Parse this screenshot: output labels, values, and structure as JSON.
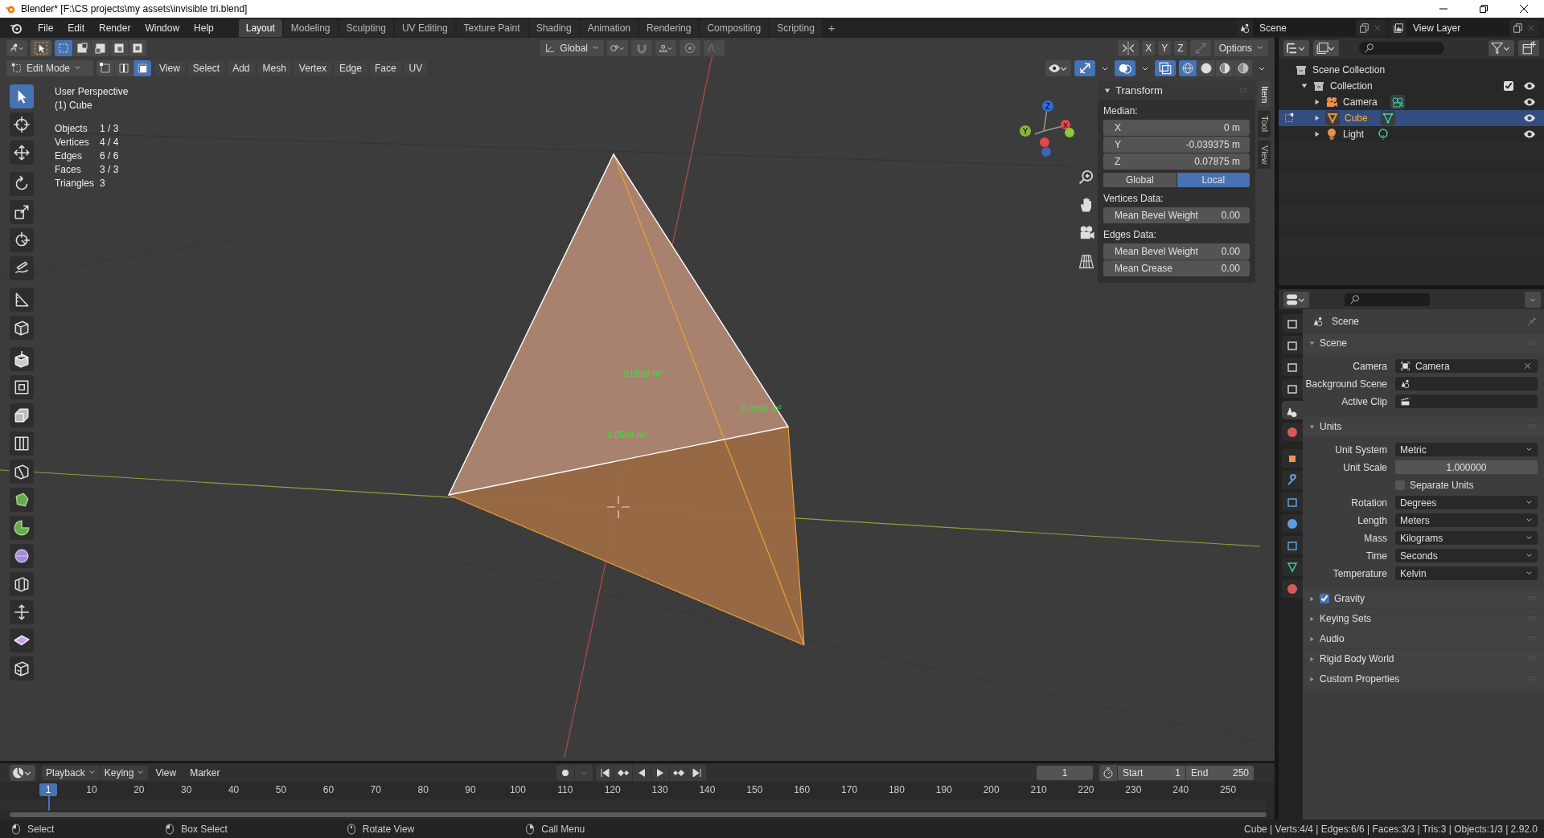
{
  "title_bar": {
    "title": "Blender* [F:\\CS projects\\my assets\\invisible tri.blend]"
  },
  "menu": [
    "File",
    "Edit",
    "Render",
    "Window",
    "Help"
  ],
  "workspaces": [
    {
      "label": "Layout",
      "selected": true
    },
    {
      "label": "Modeling",
      "selected": false
    },
    {
      "label": "Sculpting",
      "selected": false
    },
    {
      "label": "UV Editing",
      "selected": false
    },
    {
      "label": "Texture Paint",
      "selected": false
    },
    {
      "label": "Shading",
      "selected": false
    },
    {
      "label": "Animation",
      "selected": false
    },
    {
      "label": "Rendering",
      "selected": false
    },
    {
      "label": "Compositing",
      "selected": false
    },
    {
      "label": "Scripting",
      "selected": false
    }
  ],
  "add_workspace": "+",
  "scene_field": {
    "value": "Scene"
  },
  "view_layer_field": {
    "value": "View Layer"
  },
  "viewport": {
    "tool_header": {
      "select_modes": [
        {
          "selected": true
        },
        {
          "selected": false
        },
        {
          "selected": false
        },
        {
          "selected": false
        },
        {
          "selected": false
        }
      ],
      "orientation": "Global",
      "mirror_axes": [
        "X",
        "Y",
        "Z"
      ],
      "options": "Options"
    },
    "header": {
      "mode": "Edit Mode",
      "element_modes": [
        {
          "selected": false
        },
        {
          "selected": false
        },
        {
          "selected": true
        }
      ],
      "menus": [
        "View",
        "Select",
        "Add",
        "Mesh",
        "Vertex",
        "Edge",
        "Face",
        "UV"
      ],
      "gizmos_on": true,
      "overlays_on": true,
      "xray_on": true,
      "shading": [
        {
          "selected": true
        },
        {
          "selected": false
        },
        {
          "selected": false
        },
        {
          "selected": false
        }
      ]
    },
    "tools": [
      {
        "selected": true
      },
      {
        "selected": false
      },
      {
        "selected": false
      },
      {
        "selected": false
      },
      {
        "selected": false
      },
      {
        "selected": false
      },
      {
        "selected": false
      },
      {
        "selected": false
      },
      {
        "selected": false
      },
      {
        "selected": false
      },
      {
        "selected": false
      },
      {
        "selected": false
      },
      {
        "selected": false
      },
      {
        "selected": false
      },
      {
        "selected": false
      },
      {
        "selected": false
      },
      {
        "selected": false
      },
      {
        "selected": false
      },
      {
        "selected": false
      },
      {
        "selected": false
      },
      {
        "selected": false
      }
    ],
    "info": {
      "view": "User Perspective",
      "object": "(1) Cube",
      "stats": [
        {
          "label": "Objects",
          "value": "1 / 3"
        },
        {
          "label": "Vertices",
          "value": "4 / 4"
        },
        {
          "label": "Edges",
          "value": "6 / 6"
        },
        {
          "label": "Faces",
          "value": "3 / 3"
        },
        {
          "label": "Triangles",
          "value": "3"
        }
      ]
    },
    "area_labels": [
      "0.0568 m²",
      "0.0555 m²",
      "0.0568 m²"
    ],
    "gizmo_axes": [
      "X",
      "Y",
      "Z"
    ],
    "sidebar": {
      "panel": "Transform",
      "median_label": "Median:",
      "fields": [
        {
          "label": "X",
          "value": "0 m"
        },
        {
          "label": "Y",
          "value": "-0.039375 m"
        },
        {
          "label": "Z",
          "value": "0.07875 m"
        }
      ],
      "space": [
        {
          "label": "Global",
          "selected": false
        },
        {
          "label": "Local",
          "selected": true
        }
      ],
      "vertices_label": "Vertices Data:",
      "vertex_fields": [
        {
          "label": "Mean Bevel Weight",
          "value": "0.00"
        }
      ],
      "edges_label": "Edges Data:",
      "edge_fields": [
        {
          "label": "Mean Bevel Weight",
          "value": "0.00"
        },
        {
          "label": "Mean Crease",
          "value": "0.00"
        }
      ]
    },
    "tabs": [
      {
        "label": "Item",
        "selected": true
      },
      {
        "label": "Tool",
        "selected": false
      },
      {
        "label": "View",
        "selected": false
      }
    ]
  },
  "outliner": {
    "root": "Scene Collection",
    "collection": {
      "name": "Collection",
      "expanded": true,
      "checked": true,
      "children": [
        {
          "name": "Camera",
          "kind": "camera",
          "selected": false
        },
        {
          "name": "Cube",
          "kind": "mesh",
          "selected": true
        },
        {
          "name": "Light",
          "kind": "light",
          "selected": false
        }
      ]
    }
  },
  "properties": {
    "tabs": [
      {
        "selected": false
      },
      {
        "selected": false
      },
      {
        "selected": false
      },
      {
        "selected": false
      },
      {
        "selected": true
      },
      {
        "selected": false
      },
      {
        "selected": false
      },
      {
        "selected": false
      },
      {
        "selected": false
      },
      {
        "selected": false
      },
      {
        "selected": false
      },
      {
        "selected": false
      },
      {
        "selected": false
      }
    ],
    "context": "Scene",
    "panels": [
      {
        "title": "Scene",
        "expanded": true,
        "rows": [
          {
            "kind": "camera",
            "label": "Camera",
            "value": "Camera"
          },
          {
            "kind": "scene",
            "label": "Background Scene"
          },
          {
            "kind": "clip",
            "label": "Active Clip"
          }
        ]
      },
      {
        "title": "Units",
        "expanded": true,
        "rows": [
          {
            "kind": "select",
            "label": "Unit System",
            "value": "Metric"
          },
          {
            "kind": "number",
            "label": "Unit Scale",
            "value": "1.000000"
          },
          {
            "kind": "checkbox",
            "label": "Separate Units",
            "checked": false
          },
          {
            "kind": "select",
            "label": "Rotation",
            "value": "Degrees"
          },
          {
            "kind": "select",
            "label": "Length",
            "value": "Meters"
          },
          {
            "kind": "select",
            "label": "Mass",
            "value": "Kilograms"
          },
          {
            "kind": "select",
            "label": "Time",
            "value": "Seconds"
          },
          {
            "kind": "select",
            "label": "Temperature",
            "value": "Kelvin"
          }
        ]
      },
      {
        "title": "Gravity",
        "expanded": false,
        "checked": true
      },
      {
        "title": "Keying Sets",
        "expanded": false
      },
      {
        "title": "Audio",
        "expanded": false
      },
      {
        "title": "Rigid Body World",
        "expanded": false
      },
      {
        "title": "Custom Properties",
        "expanded": false
      }
    ]
  },
  "timeline": {
    "menus": [
      {
        "label": "Playback",
        "kind": "dropdown"
      },
      {
        "label": "Keying",
        "kind": "dropdown"
      },
      {
        "label": "View",
        "kind": "menu"
      },
      {
        "label": "Marker",
        "kind": "menu"
      }
    ],
    "current_frame": "1",
    "start_label": "Start",
    "start": "1",
    "end_label": "End",
    "end": "250",
    "playhead": "1",
    "ruler": [
      "10",
      "20",
      "30",
      "40",
      "50",
      "60",
      "70",
      "80",
      "90",
      "100",
      "110",
      "120",
      "130",
      "140",
      "150",
      "160",
      "170",
      "180",
      "190",
      "200",
      "210",
      "220",
      "230",
      "240",
      "250"
    ]
  },
  "status_bar": {
    "hints": [
      {
        "kind": "left",
        "label": "Select"
      },
      {
        "kind": "drag",
        "label": "Box Select"
      },
      {
        "kind": "middle",
        "label": "Rotate View"
      },
      {
        "kind": "right",
        "label": "Call Menu"
      }
    ],
    "stats": "Cube | Verts:4/4 | Edges:6/6 | Faces:3/3 | Tris:3 | Objects:1/3 | 2.92.0"
  }
}
